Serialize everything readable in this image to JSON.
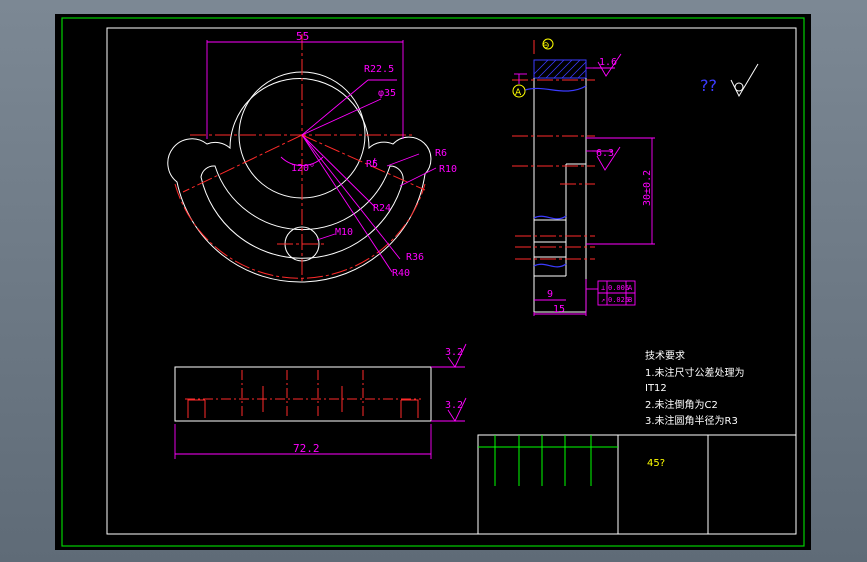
{
  "colors": {
    "background": "#000000",
    "outline": "#ffffff",
    "centerline": "#ff2a2a",
    "dimension": "#ff00ff",
    "frame": "#00d000",
    "hatch": "#3b3bff",
    "title_text": "#ffff00",
    "table_lines": "#00ff00"
  },
  "front_view": {
    "dims": {
      "width": "55",
      "r_outer_hub": "R22.5",
      "dia_bore": "φ35",
      "r6": "R6",
      "r10": "R10",
      "r5": "R5",
      "angle": "120°",
      "r24": "R24",
      "hole": "M10",
      "r36": "R36",
      "r40": "R40"
    }
  },
  "side_view": {
    "datum": "A",
    "marker": "⊖",
    "finish_top": "1.6",
    "finish_mid": "6.3",
    "dim_height": "30±0.2",
    "dim_9": "9",
    "dim_15": "15",
    "tol_1_value": "0.005",
    "tol_1_datum": "A",
    "tol_2_value": "0.025",
    "tol_2_datum": "B"
  },
  "bottom_view": {
    "finish_1": "3.2",
    "finish_2": "3.2",
    "length": "72.2"
  },
  "general_finish": {
    "text": "??"
  },
  "notes": {
    "title": "技术要求",
    "line1": "1.未注尺寸公差处理为",
    "line2": "IT12",
    "line3": "2.未注倒角为C2",
    "line4": "3.未注圆角半径为R3"
  },
  "title_block": {
    "part_name": "45?"
  }
}
